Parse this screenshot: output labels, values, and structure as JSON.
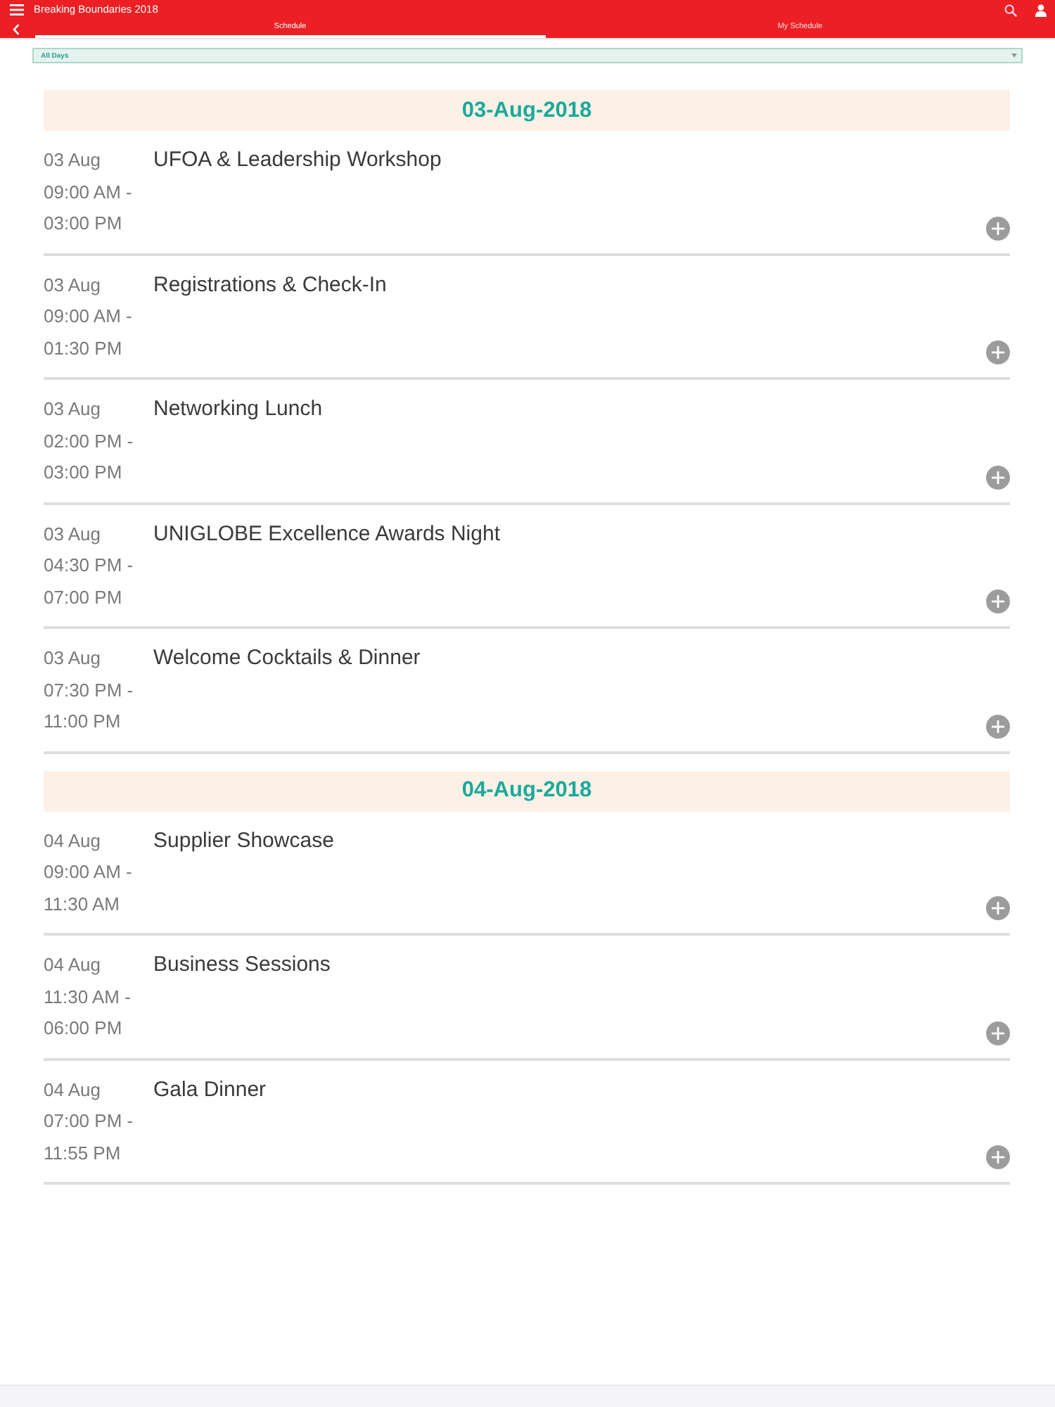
{
  "app_bar": {
    "title": "Breaking Boundaries 2018"
  },
  "tabs": [
    {
      "label": "Schedule",
      "selected": true
    },
    {
      "label": "My Schedule",
      "selected": false
    }
  ],
  "day_filter": {
    "value": "All Days"
  },
  "days": [
    {
      "heading": "03-Aug-2018",
      "sessions": [
        {
          "date": "03 Aug",
          "time_start": "09:00 AM -",
          "time_end": "03:00 PM",
          "title": "UFOA & Leadership Workshop"
        },
        {
          "date": "03 Aug",
          "time_start": "09:00 AM -",
          "time_end": "01:30 PM",
          "title": "Registrations & Check-In"
        },
        {
          "date": "03 Aug",
          "time_start": "02:00 PM -",
          "time_end": "03:00 PM",
          "title": "Networking Lunch"
        },
        {
          "date": "03 Aug",
          "time_start": "04:30 PM -",
          "time_end": "07:00 PM",
          "title": "UNIGLOBE Excellence Awards Night"
        },
        {
          "date": "03 Aug",
          "time_start": "07:30 PM -",
          "time_end": "11:00 PM",
          "title": "Welcome Cocktails & Dinner"
        }
      ]
    },
    {
      "heading": "04-Aug-2018",
      "sessions": [
        {
          "date": "04 Aug",
          "time_start": "09:00 AM -",
          "time_end": "11:30 AM",
          "title": "Supplier Showcase"
        },
        {
          "date": "04 Aug",
          "time_start": "11:30 AM -",
          "time_end": "06:00 PM",
          "title": "Business Sessions"
        },
        {
          "date": "04 Aug",
          "time_start": "07:00 PM -",
          "time_end": "11:55 PM",
          "title": "Gala Dinner"
        }
      ]
    }
  ]
}
